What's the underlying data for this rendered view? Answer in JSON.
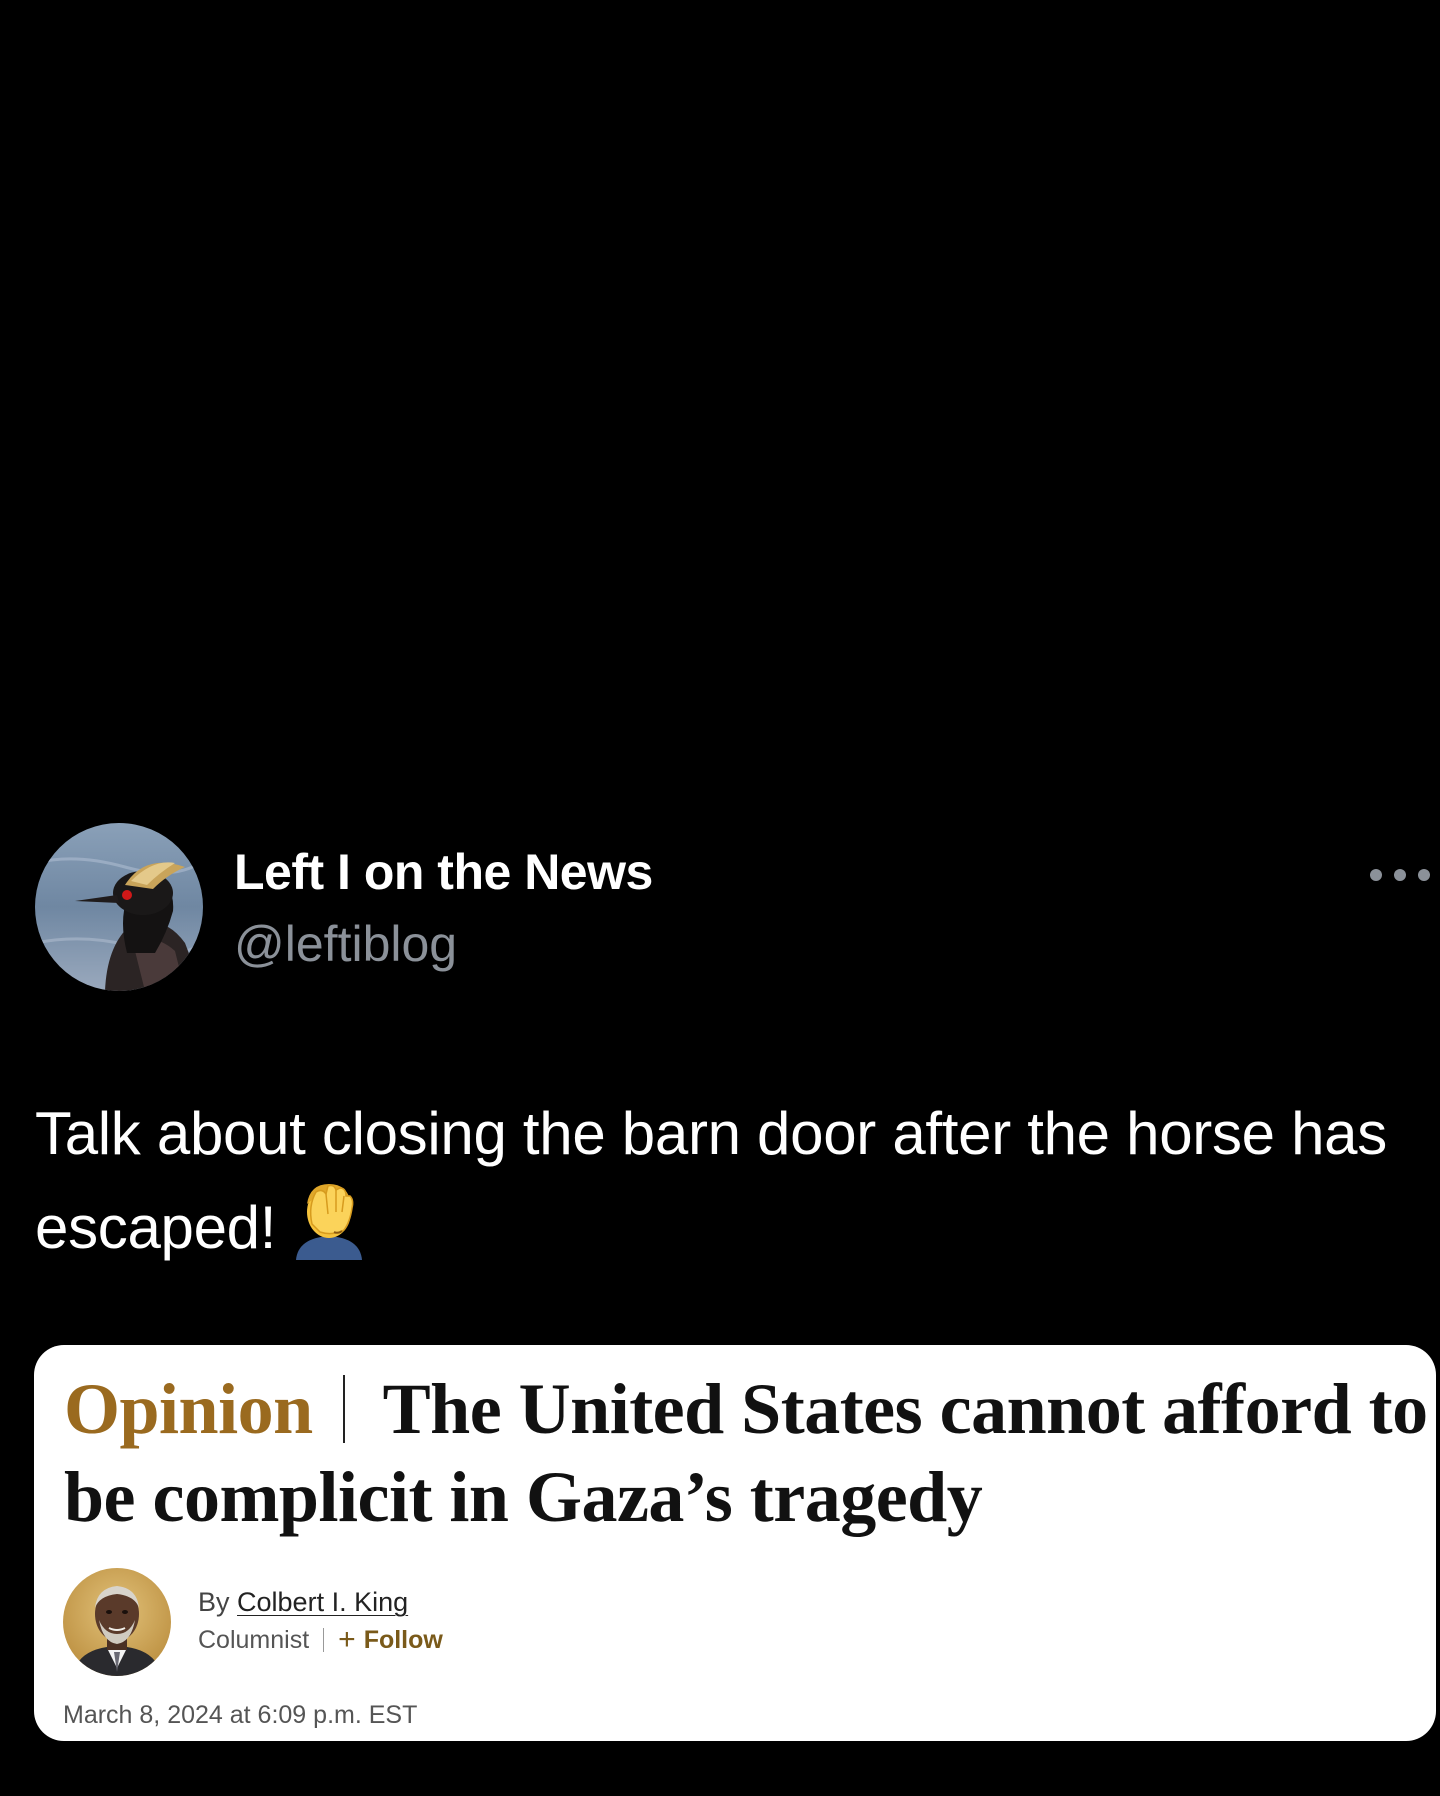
{
  "tweet": {
    "display_name": "Left I on the News",
    "handle": "@leftiblog",
    "text": "Talk about closing the barn door after the horse has escaped!",
    "emoji": "face-palm",
    "more_icon": "more-horizontal-icon"
  },
  "article": {
    "section": "Opinion",
    "headline": "The United States cannot afford to be complicit in Gaza’s tragedy",
    "byline_prefix": "By",
    "author": "Colbert I. King",
    "role": "Columnist",
    "follow_label": "Follow",
    "follow_icon": "+",
    "timestamp": "March 8, 2024 at 6:09 p.m. EST"
  },
  "colors": {
    "background": "#000000",
    "handle": "#8b9199",
    "opinion_label": "#9a6a1f",
    "follow": "#7a5a1a",
    "card": "#ffffff"
  }
}
